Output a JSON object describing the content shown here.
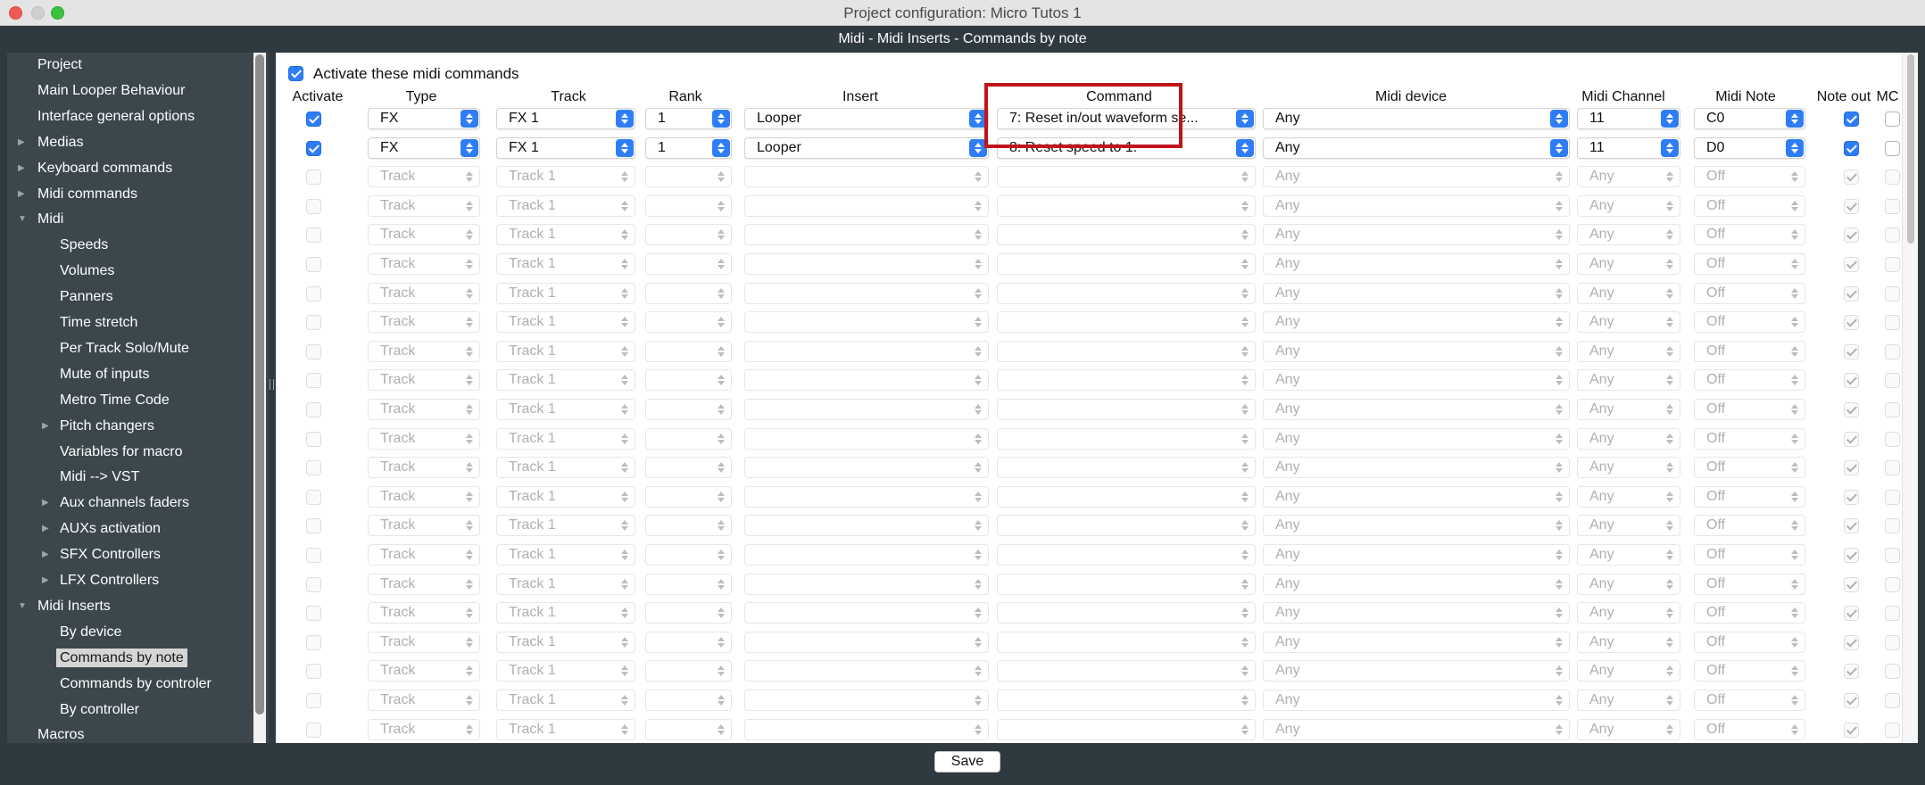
{
  "window": {
    "title": "Project configuration: Micro Tutos 1"
  },
  "panel": {
    "title": "Midi - Midi Inserts - Commands by note"
  },
  "sidebar": {
    "items": [
      {
        "label": "Project",
        "level": 0,
        "arrow": "none"
      },
      {
        "label": "Main Looper Behaviour",
        "level": 0,
        "arrow": "none"
      },
      {
        "label": "Interface general options",
        "level": 0,
        "arrow": "none"
      },
      {
        "label": "Medias",
        "level": 0,
        "arrow": "right"
      },
      {
        "label": "Keyboard commands",
        "level": 0,
        "arrow": "right"
      },
      {
        "label": "Midi commands",
        "level": 0,
        "arrow": "right"
      },
      {
        "label": "Midi",
        "level": 0,
        "arrow": "down"
      },
      {
        "label": "Speeds",
        "level": 1,
        "arrow": "none"
      },
      {
        "label": "Volumes",
        "level": 1,
        "arrow": "none"
      },
      {
        "label": "Panners",
        "level": 1,
        "arrow": "none"
      },
      {
        "label": "Time stretch",
        "level": 1,
        "arrow": "none"
      },
      {
        "label": "Per Track Solo/Mute",
        "level": 1,
        "arrow": "none"
      },
      {
        "label": "Mute of inputs",
        "level": 1,
        "arrow": "none"
      },
      {
        "label": "Metro Time Code",
        "level": 1,
        "arrow": "none"
      },
      {
        "label": "Pitch changers",
        "level": 1,
        "arrow": "right"
      },
      {
        "label": "Variables for macro",
        "level": 1,
        "arrow": "none"
      },
      {
        "label": "Midi --> VST",
        "level": 1,
        "arrow": "none"
      },
      {
        "label": "Aux channels faders",
        "level": 1,
        "arrow": "right"
      },
      {
        "label": "AUXs activation",
        "level": 1,
        "arrow": "right"
      },
      {
        "label": "SFX Controllers",
        "level": 1,
        "arrow": "right"
      },
      {
        "label": "LFX Controllers",
        "level": 1,
        "arrow": "right"
      },
      {
        "label": "Midi Inserts",
        "level": 0,
        "arrow": "down"
      },
      {
        "label": "By device",
        "level": 1,
        "arrow": "none"
      },
      {
        "label": "Commands by note",
        "level": 1,
        "arrow": "none",
        "selected": true
      },
      {
        "label": "Commands by controler",
        "level": 1,
        "arrow": "none"
      },
      {
        "label": "By controller",
        "level": 1,
        "arrow": "none"
      },
      {
        "label": "Macros",
        "level": 0,
        "arrow": "none"
      }
    ]
  },
  "main": {
    "activate_label": "Activate these midi commands",
    "activate_checked": true,
    "columns": [
      "Activate",
      "Type",
      "Track",
      "Rank",
      "Insert",
      "Command",
      "Midi device",
      "Midi Channel",
      "Midi Note",
      "Note out",
      "MC"
    ],
    "rows": [
      {
        "enabled": true,
        "activate": true,
        "type": "FX",
        "track": "FX 1",
        "rank": "1",
        "insert": "Looper",
        "command": "7: Reset in/out waveform se...",
        "device": "Any",
        "channel": "11",
        "note": "C0",
        "note_out": true,
        "mc": false
      },
      {
        "enabled": true,
        "activate": true,
        "type": "FX",
        "track": "FX 1",
        "rank": "1",
        "insert": "Looper",
        "command": "8: Reset speed to 1.",
        "device": "Any",
        "channel": "11",
        "note": "D0",
        "note_out": true,
        "mc": false
      }
    ],
    "placeholder_row": {
      "type": "Track",
      "track": "Track 1",
      "rank": "",
      "insert": "",
      "command": "",
      "device": "Any",
      "channel": "Any",
      "note": "Off",
      "note_out": true,
      "mc": false
    },
    "placeholder_count": 20
  },
  "footer": {
    "save_label": "Save"
  },
  "colors": {
    "accent": "#2f7df6",
    "highlight": "#c0141b",
    "dark_bg": "#2f3a40",
    "sidebar_bg": "#3b474d"
  }
}
